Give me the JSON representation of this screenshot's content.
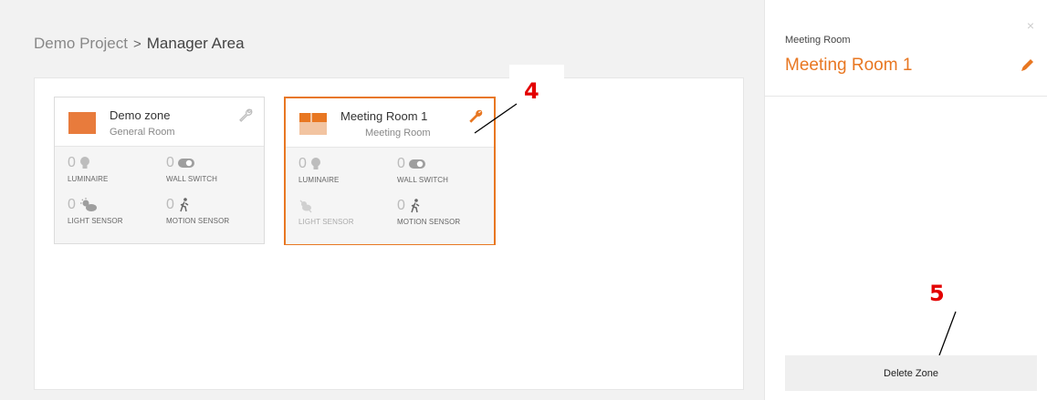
{
  "breadcrumb": {
    "project": "Demo Project",
    "separator": ">",
    "current": "Manager Area"
  },
  "zones": [
    {
      "title": "Demo zone",
      "subtitle": "General Room",
      "devices": {
        "luminaire": {
          "count": "0",
          "label": "LUMINAIRE"
        },
        "wall_switch": {
          "count": "0",
          "label": "WALL SWITCH"
        },
        "light_sensor": {
          "count": "0",
          "label": "LIGHT SENSOR"
        },
        "motion_sensor": {
          "count": "0",
          "label": "MOTION SENSOR"
        }
      }
    },
    {
      "title": "Meeting Room 1",
      "subtitle": "Meeting Room",
      "devices": {
        "luminaire": {
          "count": "0",
          "label": "LUMINAIRE"
        },
        "wall_switch": {
          "count": "0",
          "label": "WALL SWITCH"
        },
        "light_sensor": {
          "label": "LIGHT SENSOR"
        },
        "motion_sensor": {
          "count": "0",
          "label": "MOTION SENSOR"
        }
      }
    }
  ],
  "annotations": {
    "a4": "4",
    "a5": "5"
  },
  "side_panel": {
    "type_label": "Meeting Room",
    "name": "Meeting Room 1",
    "close_symbol": "×",
    "delete_label": "Delete Zone"
  },
  "colors": {
    "accent": "#e87722",
    "annotation": "#e30000",
    "icon": "#bdbdbd"
  }
}
